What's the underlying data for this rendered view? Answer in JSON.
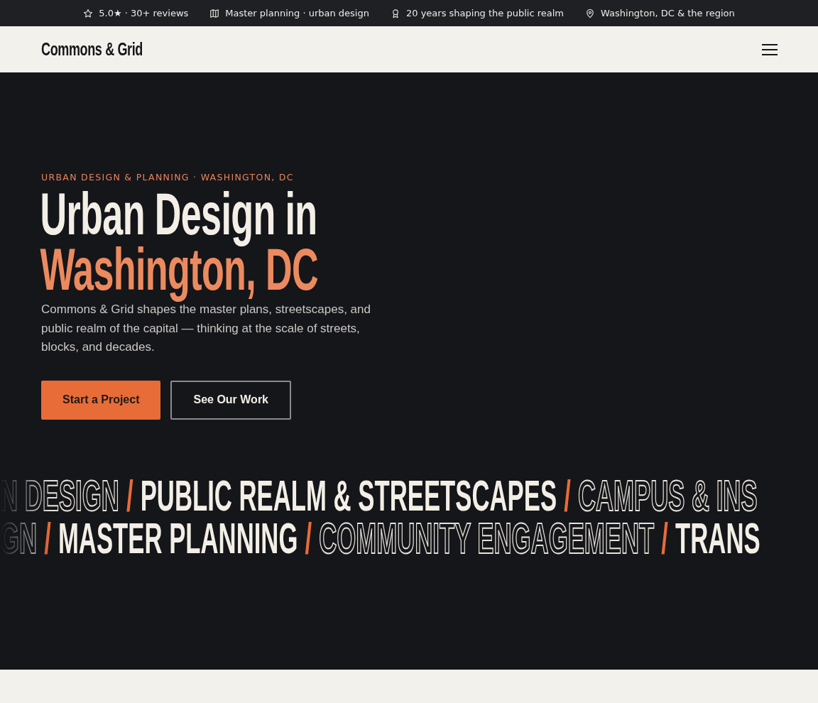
{
  "top_bar": [
    {
      "kind": "star",
      "text": "5.0★ · 30+ reviews"
    },
    {
      "kind": "map",
      "text": "Master planning · urban design"
    },
    {
      "kind": "award",
      "text": "20 years shaping the public realm"
    },
    {
      "kind": "pin",
      "text": "Washington, DC & the region"
    }
  ],
  "nav": {
    "logo": "Commons & Grid"
  },
  "hero": {
    "eyebrow": "URBAN DESIGN & PLANNING · WASHINGTON, DC",
    "title_lines": [
      {
        "text": "Urban Design in",
        "accent": false
      },
      {
        "text": "Washington, DC",
        "accent": true
      }
    ],
    "lead": "Commons & Grid shapes the master plans, streetscapes, and public realm of the capital — thinking at the scale of streets, blocks, and decades.",
    "buttons": [
      {
        "label": "Start a Project",
        "kind": "primary"
      },
      {
        "label": "See Our Work",
        "kind": "outline"
      }
    ]
  },
  "marquee": [
    {
      "items": [
        {
          "text": "N DESIGN",
          "kind": "outline"
        },
        {
          "text": "/",
          "kind": "slash"
        },
        {
          "text": "PUBLIC REALM & STREETSCAPES",
          "kind": "solid"
        },
        {
          "text": "/",
          "kind": "slash"
        },
        {
          "text": "CAMPUS & INS",
          "kind": "outline"
        }
      ]
    },
    {
      "items": [
        {
          "text": "GN",
          "kind": "outline"
        },
        {
          "text": "/",
          "kind": "slash"
        },
        {
          "text": "MASTER PLANNING",
          "kind": "solid"
        },
        {
          "text": "/",
          "kind": "slash"
        },
        {
          "text": "COMMUNITY ENGAGEMENT",
          "kind": "outline"
        },
        {
          "text": "/",
          "kind": "slash"
        },
        {
          "text": "TRANS",
          "kind": "solid"
        }
      ]
    }
  ]
}
